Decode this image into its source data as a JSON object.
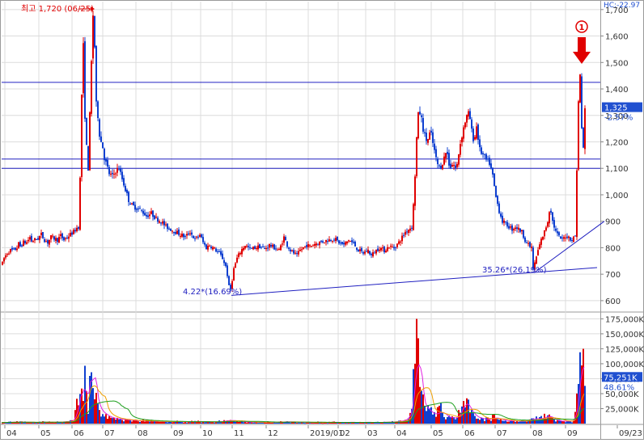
{
  "chart_data": [
    {
      "type": "candlestick",
      "panel": "price",
      "ylim": [
        560,
        1730
      ],
      "yticks": [
        600,
        700,
        800,
        900,
        1000,
        1100,
        1200,
        1300,
        1400,
        1500,
        1600,
        1700
      ],
      "ytick_labels": [
        "600",
        "700",
        "800",
        "900",
        "1,000",
        "1,100",
        "1,200",
        "1,300",
        "1,400",
        "1,500",
        "1,600",
        "1,700"
      ],
      "grid": true,
      "up_color": "#e00000",
      "down_color": "#1040d0",
      "series_points": [
        [
          0,
          740
        ],
        [
          2,
          760
        ],
        [
          6,
          780
        ],
        [
          10,
          790
        ],
        [
          14,
          790
        ],
        [
          18,
          800
        ],
        [
          20,
          815
        ],
        [
          22,
          805
        ],
        [
          26,
          820
        ],
        [
          30,
          820
        ],
        [
          34,
          840
        ],
        [
          36,
          825
        ],
        [
          40,
          830
        ],
        [
          44,
          835
        ],
        [
          48,
          850
        ],
        [
          52,
          830
        ],
        [
          56,
          820
        ],
        [
          60,
          840
        ],
        [
          64,
          835
        ],
        [
          68,
          830
        ],
        [
          72,
          845
        ],
        [
          76,
          830
        ],
        [
          80,
          840
        ],
        [
          84,
          850
        ],
        [
          88,
          860
        ],
        [
          92,
          875
        ],
        [
          94,
          880
        ],
        [
          97,
          1150
        ],
        [
          98,
          1380
        ],
        [
          99,
          1650
        ],
        [
          100,
          1560
        ],
        [
          102,
          1300
        ],
        [
          104,
          1180
        ],
        [
          106,
          1100
        ],
        [
          108,
          1300
        ],
        [
          110,
          1500
        ],
        [
          112,
          1680
        ],
        [
          113,
          1720
        ],
        [
          114,
          1560
        ],
        [
          115,
          1450
        ],
        [
          116,
          1340
        ],
        [
          118,
          1300
        ],
        [
          120,
          1230
        ],
        [
          122,
          1200
        ],
        [
          124,
          1180
        ],
        [
          126,
          1140
        ],
        [
          128,
          1120
        ],
        [
          132,
          1080
        ],
        [
          136,
          1070
        ],
        [
          140,
          1090
        ],
        [
          144,
          1100
        ],
        [
          148,
          1060
        ],
        [
          152,
          1020
        ],
        [
          156,
          980
        ],
        [
          160,
          960
        ],
        [
          166,
          950
        ],
        [
          172,
          940
        ],
        [
          178,
          920
        ],
        [
          184,
          930
        ],
        [
          190,
          910
        ],
        [
          196,
          900
        ],
        [
          202,
          880
        ],
        [
          208,
          870
        ],
        [
          214,
          860
        ],
        [
          220,
          850
        ],
        [
          226,
          840
        ],
        [
          232,
          860
        ],
        [
          238,
          830
        ],
        [
          244,
          850
        ],
        [
          248,
          820
        ],
        [
          252,
          800
        ],
        [
          256,
          810
        ],
        [
          260,
          800
        ],
        [
          264,
          790
        ],
        [
          268,
          780
        ],
        [
          272,
          760
        ],
        [
          276,
          730
        ],
        [
          279,
          680
        ],
        [
          281,
          625
        ],
        [
          283,
          660
        ],
        [
          286,
          720
        ],
        [
          290,
          760
        ],
        [
          295,
          790
        ],
        [
          300,
          810
        ],
        [
          306,
          795
        ],
        [
          312,
          800
        ],
        [
          318,
          805
        ],
        [
          324,
          795
        ],
        [
          330,
          810
        ],
        [
          336,
          800
        ],
        [
          342,
          790
        ],
        [
          348,
          840
        ],
        [
          352,
          810
        ],
        [
          356,
          790
        ],
        [
          360,
          780
        ],
        [
          364,
          770
        ],
        [
          368,
          790
        ],
        [
          372,
          800
        ],
        [
          376,
          810
        ],
        [
          380,
          805
        ],
        [
          386,
          815
        ],
        [
          392,
          820
        ],
        [
          398,
          825
        ],
        [
          404,
          830
        ],
        [
          410,
          835
        ],
        [
          416,
          820
        ],
        [
          422,
          810
        ],
        [
          428,
          830
        ],
        [
          434,
          815
        ],
        [
          440,
          790
        ],
        [
          446,
          780
        ],
        [
          452,
          790
        ],
        [
          456,
          770
        ],
        [
          460,
          785
        ],
        [
          466,
          800
        ],
        [
          472,
          790
        ],
        [
          478,
          805
        ],
        [
          484,
          800
        ],
        [
          490,
          820
        ],
        [
          494,
          840
        ],
        [
          498,
          860
        ],
        [
          502,
          870
        ],
        [
          506,
          880
        ],
        [
          509,
          1000
        ],
        [
          511,
          1150
        ],
        [
          513,
          1280
        ],
        [
          515,
          1320
        ],
        [
          517,
          1300
        ],
        [
          519,
          1270
        ],
        [
          521,
          1230
        ],
        [
          525,
          1200
        ],
        [
          529,
          1240
        ],
        [
          533,
          1180
        ],
        [
          537,
          1120
        ],
        [
          541,
          1100
        ],
        [
          545,
          1130
        ],
        [
          549,
          1170
        ],
        [
          553,
          1100
        ],
        [
          557,
          1120
        ],
        [
          561,
          1090
        ],
        [
          565,
          1180
        ],
        [
          569,
          1240
        ],
        [
          573,
          1290
        ],
        [
          577,
          1310
        ],
        [
          580,
          1240
        ],
        [
          583,
          1200
        ],
        [
          586,
          1260
        ],
        [
          590,
          1170
        ],
        [
          594,
          1150
        ],
        [
          598,
          1130
        ],
        [
          602,
          1120
        ],
        [
          606,
          1070
        ],
        [
          610,
          990
        ],
        [
          614,
          940
        ],
        [
          618,
          900
        ],
        [
          622,
          890
        ],
        [
          626,
          880
        ],
        [
          630,
          870
        ],
        [
          634,
          880
        ],
        [
          638,
          870
        ],
        [
          642,
          860
        ],
        [
          646,
          830
        ],
        [
          650,
          810
        ],
        [
          654,
          800
        ],
        [
          656,
          720
        ],
        [
          658,
          740
        ],
        [
          662,
          790
        ],
        [
          666,
          830
        ],
        [
          670,
          860
        ],
        [
          674,
          900
        ],
        [
          677,
          960
        ],
        [
          680,
          900
        ],
        [
          684,
          860
        ],
        [
          688,
          840
        ],
        [
          692,
          830
        ],
        [
          696,
          845
        ],
        [
          700,
          840
        ],
        [
          704,
          830
        ],
        [
          708,
          845
        ],
        [
          712,
          1350
        ],
        [
          714,
          1450
        ],
        [
          716,
          1250
        ],
        [
          718,
          1180
        ],
        [
          720,
          1320
        ]
      ],
      "price_label": "1,325",
      "change_label": "-2.57%",
      "corner_label": "HC:-22.97",
      "annotations": {
        "high_label": "최고 1,720 (06/25)",
        "low_left_label": "4.22*(16.69%)",
        "low_right_label": "35.26*(26.19%)",
        "marker_label": "①"
      },
      "horizontal_lines": [
        1425,
        1135,
        1100
      ],
      "trendlines": [
        {
          "from": [
            284,
            620
          ],
          "to": [
            736,
            725
          ]
        },
        {
          "from": [
            658,
            705
          ],
          "to": [
            745,
            900
          ]
        }
      ]
    },
    {
      "type": "bar",
      "panel": "volume",
      "ylim": [
        0,
        185000
      ],
      "yticks": [
        25000,
        50000,
        75000,
        100000,
        125000,
        150000,
        175000
      ],
      "ytick_labels": [
        "25,000K",
        "50,000K",
        "75,000K",
        "100,000K",
        "125,000K",
        "150,000K",
        "175,000K"
      ],
      "current_volume_label": "75,251K",
      "volume_ratio_label": "48.61%",
      "grid": true,
      "bar_colors": {
        "up": "#e00000",
        "down": "#1040d0"
      },
      "series_points": [
        [
          0,
          2000
        ],
        [
          10,
          2500
        ],
        [
          20,
          3000
        ],
        [
          30,
          2500
        ],
        [
          40,
          2000
        ],
        [
          50,
          3000
        ],
        [
          60,
          2500
        ],
        [
          70,
          3000
        ],
        [
          80,
          4000
        ],
        [
          88,
          5000
        ],
        [
          96,
          60000
        ],
        [
          98,
          95000
        ],
        [
          100,
          45000
        ],
        [
          102,
          70000
        ],
        [
          104,
          40000
        ],
        [
          106,
          30000
        ],
        [
          108,
          100000
        ],
        [
          110,
          150000
        ],
        [
          112,
          80000
        ],
        [
          114,
          55000
        ],
        [
          116,
          40000
        ],
        [
          118,
          30000
        ],
        [
          120,
          25000
        ],
        [
          124,
          20000
        ],
        [
          128,
          15000
        ],
        [
          132,
          12000
        ],
        [
          136,
          10000
        ],
        [
          140,
          9000
        ],
        [
          146,
          8000
        ],
        [
          152,
          7000
        ],
        [
          160,
          6000
        ],
        [
          170,
          5000
        ],
        [
          180,
          5000
        ],
        [
          190,
          4000
        ],
        [
          200,
          3500
        ],
        [
          210,
          4000
        ],
        [
          220,
          3500
        ],
        [
          230,
          3000
        ],
        [
          240,
          4000
        ],
        [
          250,
          3500
        ],
        [
          260,
          3000
        ],
        [
          270,
          4000
        ],
        [
          280,
          6000
        ],
        [
          290,
          5000
        ],
        [
          300,
          3000
        ],
        [
          310,
          2500
        ],
        [
          320,
          2500
        ],
        [
          330,
          3000
        ],
        [
          340,
          2500
        ],
        [
          350,
          3500
        ],
        [
          360,
          3000
        ],
        [
          370,
          2500
        ],
        [
          380,
          2000
        ],
        [
          390,
          2500
        ],
        [
          400,
          2000
        ],
        [
          410,
          2500
        ],
        [
          420,
          2000
        ],
        [
          430,
          2500
        ],
        [
          440,
          2000
        ],
        [
          450,
          2500
        ],
        [
          460,
          2000
        ],
        [
          470,
          2500
        ],
        [
          480,
          3000
        ],
        [
          490,
          4000
        ],
        [
          500,
          8000
        ],
        [
          506,
          30000
        ],
        [
          510,
          110000
        ],
        [
          512,
          175000
        ],
        [
          514,
          130000
        ],
        [
          516,
          60000
        ],
        [
          518,
          40000
        ],
        [
          522,
          30000
        ],
        [
          526,
          25000
        ],
        [
          530,
          20000
        ],
        [
          534,
          15000
        ],
        [
          538,
          20000
        ],
        [
          542,
          25000
        ],
        [
          546,
          15000
        ],
        [
          550,
          12000
        ],
        [
          556,
          10000
        ],
        [
          560,
          10000
        ],
        [
          566,
          20000
        ],
        [
          570,
          45000
        ],
        [
          574,
          35000
        ],
        [
          578,
          25000
        ],
        [
          582,
          15000
        ],
        [
          586,
          12000
        ],
        [
          590,
          10000
        ],
        [
          596,
          8000
        ],
        [
          602,
          8000
        ],
        [
          608,
          12000
        ],
        [
          614,
          8000
        ],
        [
          620,
          6000
        ],
        [
          626,
          5000
        ],
        [
          632,
          5000
        ],
        [
          638,
          4000
        ],
        [
          644,
          5000
        ],
        [
          650,
          6000
        ],
        [
          656,
          10000
        ],
        [
          662,
          8000
        ],
        [
          670,
          12000
        ],
        [
          676,
          15000
        ],
        [
          682,
          6000
        ],
        [
          688,
          5000
        ],
        [
          694,
          4000
        ],
        [
          700,
          5000
        ],
        [
          706,
          4000
        ],
        [
          712,
          60000
        ],
        [
          714,
          125000
        ],
        [
          716,
          155000
        ],
        [
          718,
          110000
        ],
        [
          720,
          75000
        ]
      ]
    }
  ],
  "x_axis": {
    "labels": [
      "04",
      "05",
      "06",
      "07",
      "08",
      "09",
      "10",
      "11",
      "12",
      "2019/01",
      "02",
      "03",
      "04",
      "05",
      "06",
      "07",
      "08",
      "09",
      "09/23"
    ]
  }
}
